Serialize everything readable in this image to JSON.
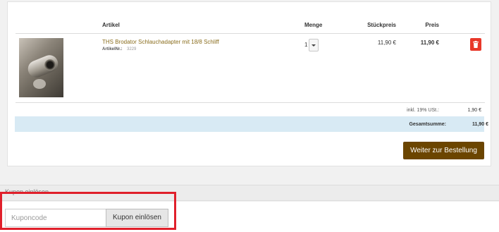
{
  "table": {
    "headers": {
      "article": "Artikel",
      "quantity": "Menge",
      "unit_price": "Stückpreis",
      "price": "Preis"
    }
  },
  "item": {
    "name": "THS Brodator Schlauchadapter mit 18/8 Schliff",
    "number_label": "ArtikelNr.:",
    "number": "3229",
    "quantity": "1",
    "unit_price": "11,90 €",
    "total": "11,90 €",
    "image_icon": "product-photo"
  },
  "summary": {
    "tax_label": "inkl. 19% USt.:",
    "tax_value": "1,90 €",
    "total_label": "Gesamtsumme:",
    "total_value": "11,90 €"
  },
  "actions": {
    "checkout": "Weiter zur Bestellung"
  },
  "coupon": {
    "title": "Kupon einlösen",
    "input_placeholder": "Kuponcode",
    "button": "Kupon einlösen"
  },
  "colors": {
    "checkout_button": "#6b4500",
    "delete_button": "#e8382a",
    "total_bar": "#d8eaf4",
    "highlight": "#e0202b",
    "product_link": "#8a6d1d"
  }
}
